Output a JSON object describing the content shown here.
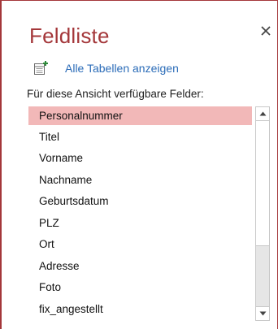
{
  "pane": {
    "title": "Feldliste",
    "close_icon": "close-icon",
    "add_table_icon": "table-add-icon",
    "show_all_tables_label": "Alle Tabellen anzeigen",
    "fields_heading": "Für diese Ansicht verfügbare Felder:"
  },
  "fields": {
    "items": [
      {
        "label": "Personalnummer",
        "selected": true
      },
      {
        "label": "Titel"
      },
      {
        "label": "Vorname"
      },
      {
        "label": "Nachname"
      },
      {
        "label": "Geburtsdatum"
      },
      {
        "label": "PLZ"
      },
      {
        "label": "Ort"
      },
      {
        "label": "Adresse"
      },
      {
        "label": "Foto"
      },
      {
        "label": "fix_angestellt"
      }
    ]
  },
  "colors": {
    "accent": "#a4373a",
    "link": "#2b6cb8",
    "selection": "#f2b8b8"
  }
}
